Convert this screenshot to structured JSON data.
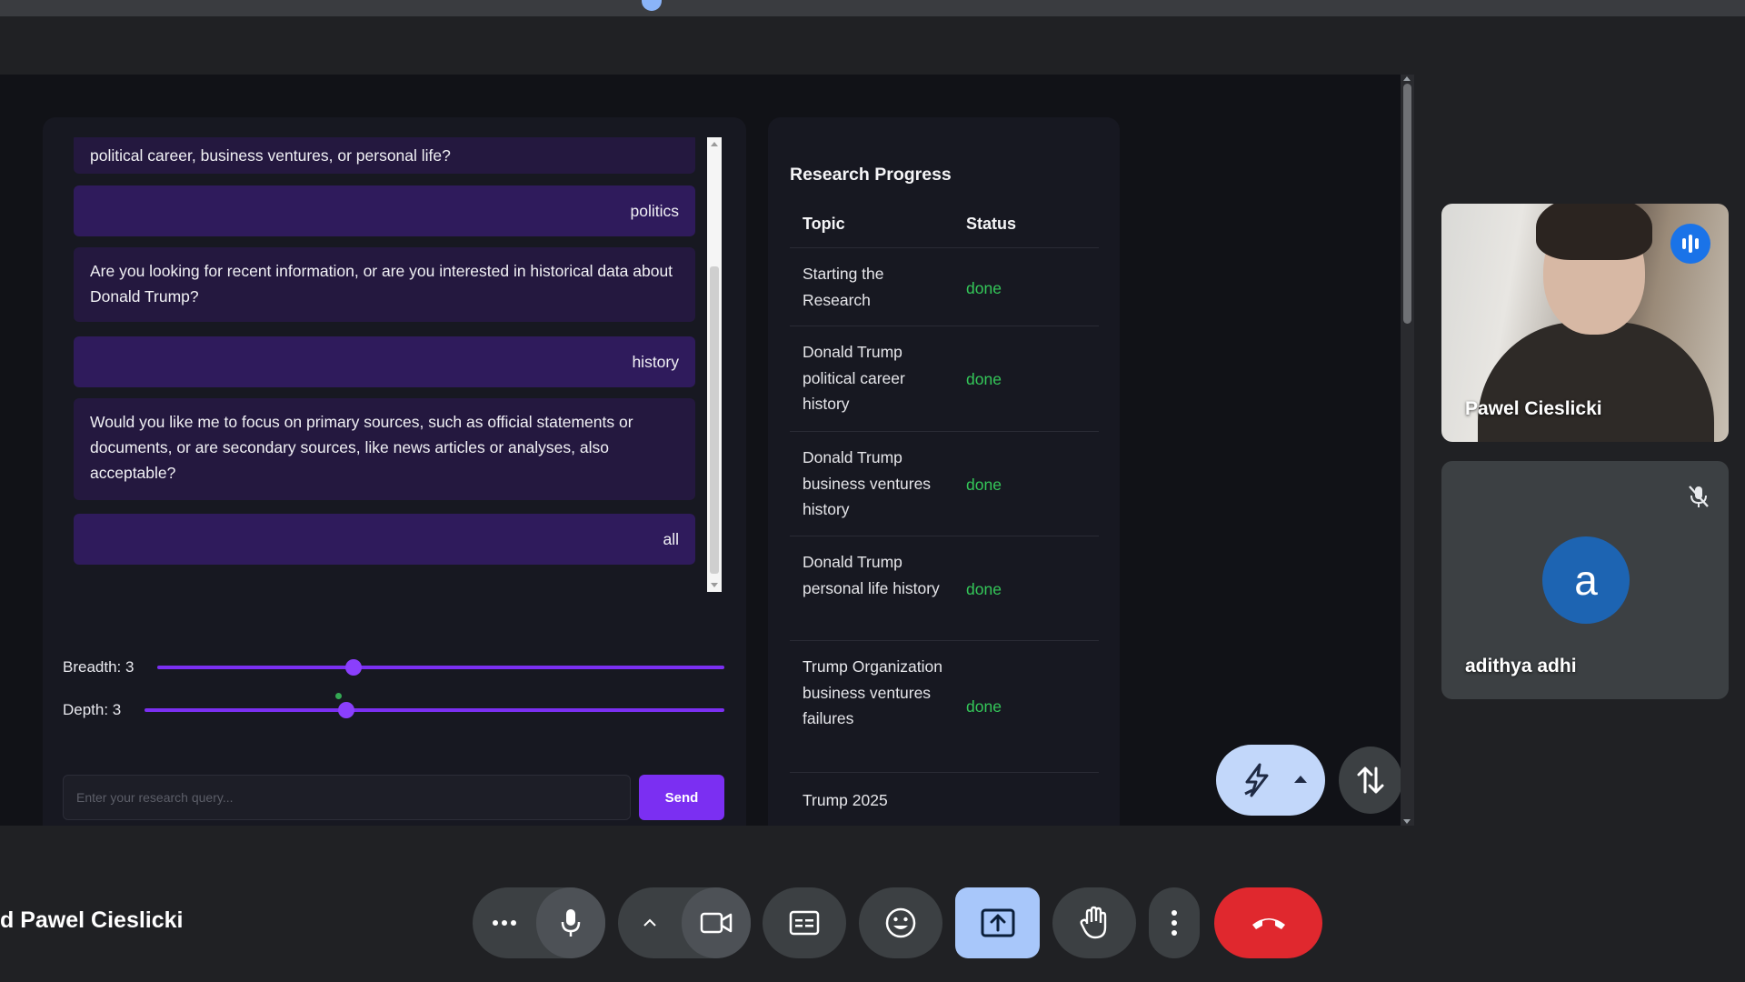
{
  "chat": {
    "messages": [
      {
        "role": "assistant",
        "text": "political career, business ventures, or personal life?"
      },
      {
        "role": "user",
        "text": "politics"
      },
      {
        "role": "assistant",
        "text": "Are you looking for recent information, or are you interested in historical data about Donald Trump?"
      },
      {
        "role": "user",
        "text": "history"
      },
      {
        "role": "assistant",
        "text": "Would you like me to focus on primary sources, such as official statements or documents, or are secondary sources, like news articles or analyses, also acceptable?"
      },
      {
        "role": "user",
        "text": "all"
      }
    ],
    "breadth_label": "Breadth: 3",
    "depth_label": "Depth: 3",
    "breadth_value": 3,
    "depth_value": 3,
    "query_placeholder": "Enter your research query...",
    "send_label": "Send"
  },
  "research": {
    "title": "Research Progress",
    "col_topic": "Topic",
    "col_status": "Status",
    "rows": [
      {
        "topic": "Starting the Research",
        "status": "done"
      },
      {
        "topic": "Donald Trump political career history",
        "status": "done"
      },
      {
        "topic": "Donald Trump business ventures history",
        "status": "done"
      },
      {
        "topic": "Donald Trump personal life history",
        "status": "done"
      },
      {
        "topic": "Trump Organization business ventures failures",
        "status": "done"
      },
      {
        "topic": "Trump 2025",
        "status": ""
      }
    ]
  },
  "participants": [
    {
      "name": "Pawel Cieslicki",
      "speaking": true,
      "icon": "speaking-indicator-icon"
    },
    {
      "name": "adithya adhi",
      "avatar_letter": "a",
      "muted": true,
      "icon": "mic-off-icon"
    }
  ],
  "meeting": {
    "presenter_label": "d Pawel Cieslicki"
  },
  "controls": [
    "more-options-icon",
    "mic-icon",
    "chevron-up-icon",
    "camera-icon",
    "captions-icon",
    "emoji-icon",
    "present-screen-icon",
    "raise-hand-icon",
    "more-vert-icon",
    "end-call-icon"
  ],
  "colors": {
    "accent": "#7b2ff2",
    "status_done": "#34c759",
    "leave": "#e0282e",
    "present": "#a8c7fa"
  }
}
